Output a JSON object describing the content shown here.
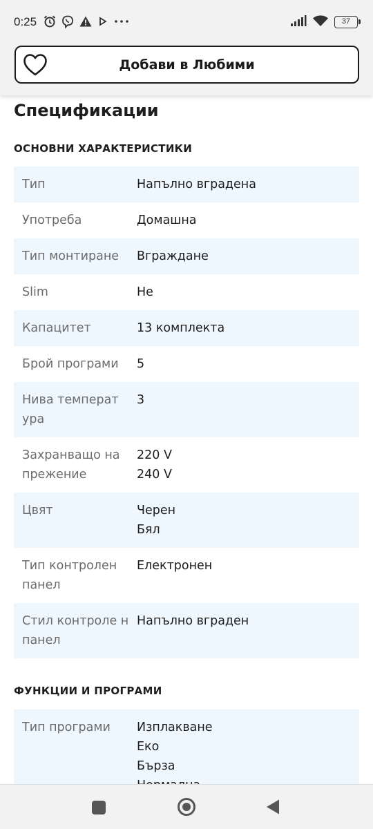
{
  "status_bar": {
    "time": "0:25",
    "battery": "37",
    "icons_left": [
      "alarm-icon",
      "viber-icon",
      "warning-icon",
      "play-icon",
      "more-icon"
    ],
    "icons_right": [
      "signal-icon",
      "wifi-icon",
      "battery-icon"
    ]
  },
  "favorites": {
    "label": "Добави в Любими",
    "icon": "heart-outline-icon"
  },
  "page": {
    "title": "Спецификации"
  },
  "sections": [
    {
      "title": "ОСНОВНИ ХАРАКТЕРИСТИКИ",
      "rows": [
        {
          "key": "Тип",
          "values": [
            "Напълно вградена"
          ]
        },
        {
          "key": "Употреба",
          "values": [
            "Домашна"
          ]
        },
        {
          "key": "Тип монтиране",
          "values": [
            "Вграждане"
          ]
        },
        {
          "key": "Slim",
          "values": [
            "Не"
          ]
        },
        {
          "key": "Капацитет",
          "values": [
            "13 комплекта"
          ]
        },
        {
          "key": "Брой програми",
          "values": [
            "5"
          ]
        },
        {
          "key": "Нива температ ура",
          "values": [
            "3"
          ]
        },
        {
          "key": "Захранващо на прежение",
          "values": [
            "220 V",
            "240 V"
          ]
        },
        {
          "key": "Цвят",
          "values": [
            "Черен",
            "Бял"
          ]
        },
        {
          "key": "Тип контролен панел",
          "values": [
            "Електронен"
          ]
        },
        {
          "key": "Стил контроле н панел",
          "values": [
            "Напълно вграден"
          ]
        }
      ]
    },
    {
      "title": "ФУНКЦИИ И ПРОГРАМИ",
      "rows": [
        {
          "key": "Тип програми",
          "values": [
            "Изплакване",
            "Еко",
            "Бърза",
            "Нормална"
          ]
        }
      ]
    }
  ],
  "nav_bar": {
    "icons": [
      "recents-square-icon",
      "home-circle-icon",
      "back-triangle-icon"
    ]
  },
  "colors": {
    "row_shade": "#eef7fd",
    "key_text": "#6b6b6b",
    "value_text": "#1e1e1e",
    "chrome_bg": "#f2f2f2"
  }
}
